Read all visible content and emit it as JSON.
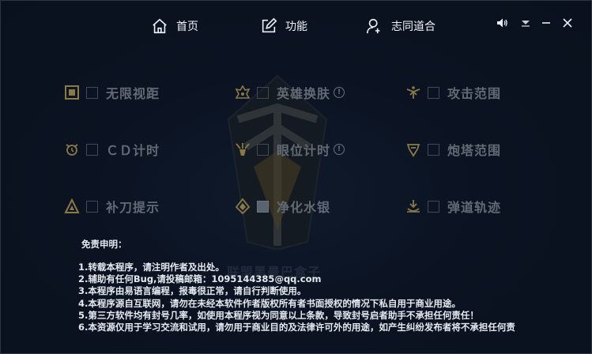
{
  "nav": {
    "home": "首页",
    "features": "功能",
    "about": "志同道合"
  },
  "features": [
    {
      "label": "无限视距",
      "checked": false,
      "info": false,
      "icon": "vision-frame-icon"
    },
    {
      "label": "英雄换肤",
      "checked": false,
      "info": true,
      "icon": "hero-skin-icon"
    },
    {
      "label": "攻击范围",
      "checked": false,
      "info": false,
      "icon": "attack-range-icon"
    },
    {
      "label": "ＣＤ计时",
      "checked": false,
      "info": false,
      "icon": "cooldown-timer-icon"
    },
    {
      "label": "眼位计时",
      "checked": false,
      "info": true,
      "icon": "ward-timer-icon"
    },
    {
      "label": "炮塔范围",
      "checked": false,
      "info": false,
      "icon": "tower-range-icon"
    },
    {
      "label": "补刀提示",
      "checked": false,
      "info": false,
      "icon": "last-hit-icon"
    },
    {
      "label": "净化水银",
      "checked": true,
      "info": false,
      "icon": "cleanse-icon"
    },
    {
      "label": "弹道轨迹",
      "checked": false,
      "info": false,
      "icon": "projectile-icon"
    }
  ],
  "disclaimer": {
    "title": "免责申明：",
    "lines": [
      "1.转载本程序，请注明作者及出处。",
      "2.辅助有任何Bug,请投稿邮箱：1095144385@qq.com",
      "3.本程序由易语言编程，报毒很正常，请自行判断使用。",
      "4.本程序源自互联网，请勿在未经本软件作者版权所有者书面授权的情况下私自用于商业用途。",
      "5.第三方软件均有封号几率，如使用本程序视为同意以上条款，导致封号启者助手不承担任何责任！",
      "6.本资源仅用于学习交流和试用，请勿用于商业目的及法律许可外的用途，如产生纠纷发布者将不承担任何责"
    ]
  },
  "watermark": "联盟黑曼巴盒子",
  "colors": {
    "background": "#0b1322",
    "label": "#626a74",
    "accent": "#b89a4a"
  }
}
